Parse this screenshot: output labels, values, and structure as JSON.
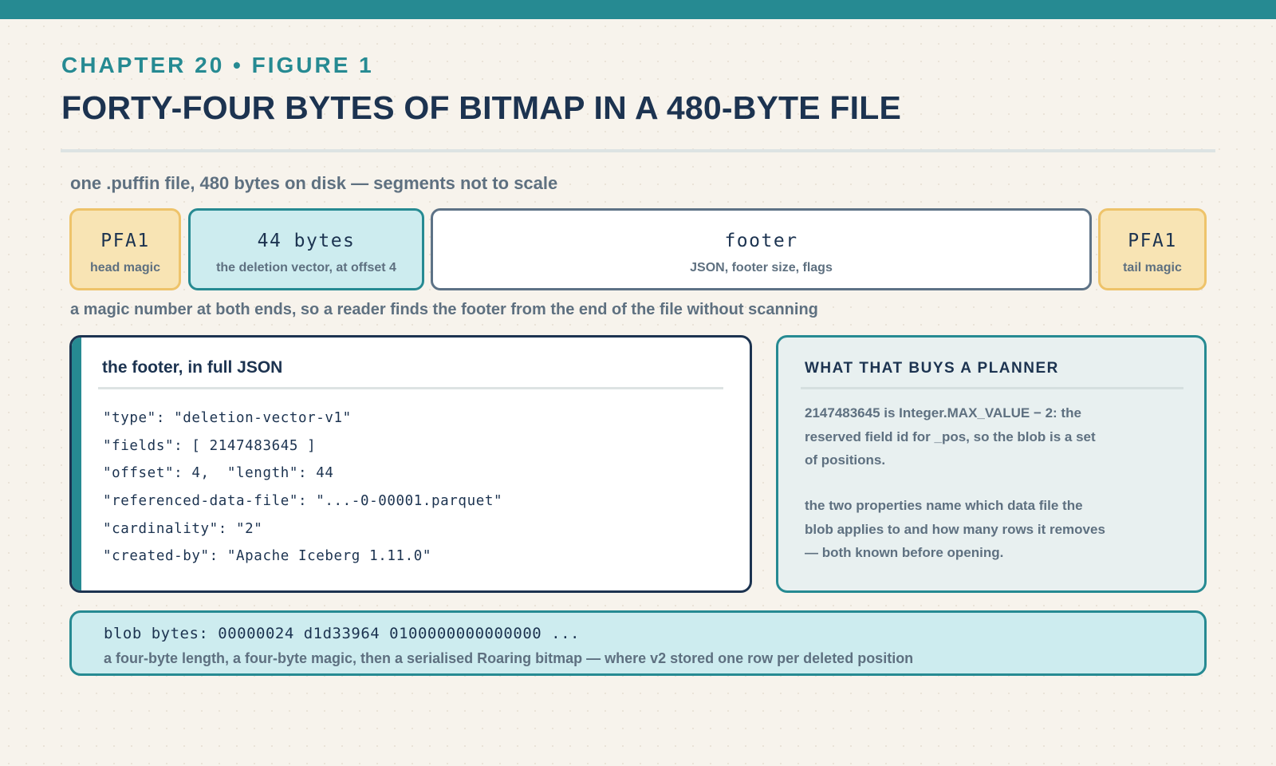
{
  "header": {
    "kicker": "CHAPTER 20 • FIGURE 1",
    "title": "FORTY-FOUR BYTES OF BITMAP IN A 480-BYTE FILE"
  },
  "file_layout": {
    "subtitle": "one .puffin file, 480 bytes on disk — segments not to scale",
    "segments": [
      {
        "label": "PFA1",
        "caption": "head magic"
      },
      {
        "label": "44 bytes",
        "caption": "the deletion vector, at offset 4"
      },
      {
        "label": "footer",
        "caption": "JSON, footer size, flags"
      },
      {
        "label": "PFA1",
        "caption": "tail magic"
      }
    ],
    "caption": "a magic number at both ends, so a reader finds the footer from the end of the file without scanning"
  },
  "footer_card": {
    "title": "the footer, in full JSON",
    "lines": [
      "\"type\": \"deletion-vector-v1\"",
      "\"fields\": [ 2147483645 ]",
      "\"offset\": 4,  \"length\": 44",
      "\"referenced-data-file\": \"...-0-00001.parquet\"",
      "\"cardinality\": \"2\"",
      "\"created-by\": \"Apache Iceberg 1.11.0\""
    ]
  },
  "planner_card": {
    "title": "WHAT THAT BUYS A PLANNER",
    "paragraph_1": "2147483645 is Integer.MAX_VALUE − 2: the reserved field id for _pos, so the blob is a set of positions.",
    "paragraph_2": "the two properties name which data file the blob applies to and how many rows it removes — both known before opening."
  },
  "blob": {
    "bytes": "blob bytes: 00000024 d1d33964 0100000000000000 ...",
    "description": "a four-byte length, a four-byte magic, then a serialised Roaring bitmap — where v2 stored one row per deleted position"
  },
  "colors": {
    "accent": "#268a92",
    "navy": "#1c3350",
    "magic_fill": "#f8e4b4",
    "magic_border": "#eec36a",
    "bitmap_fill": "#cdecef"
  }
}
